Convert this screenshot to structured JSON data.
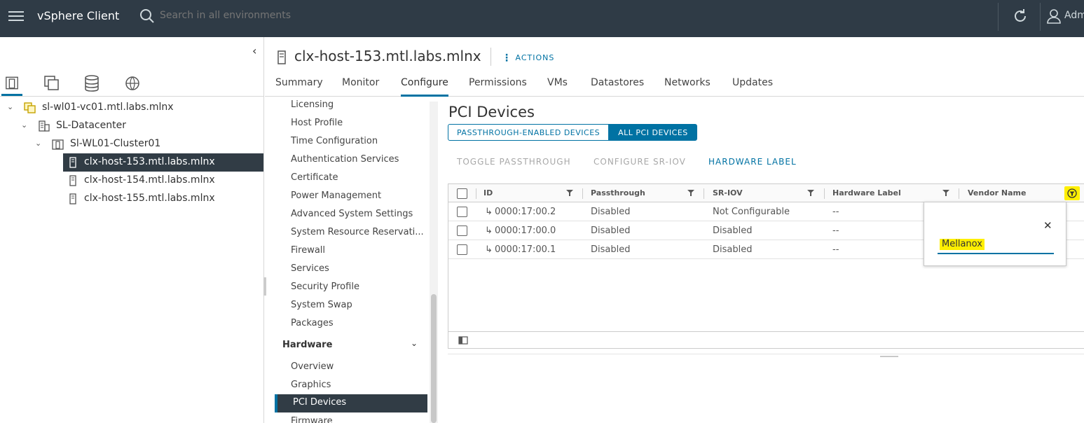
{
  "topbar": {
    "app_title": "vSphere Client",
    "search_placeholder": "Search in all environments",
    "user_label": "Adm"
  },
  "nav_tree": {
    "items": [
      {
        "label": "sl-wl01-vc01.mtl.labs.mlnx",
        "type": "vcenter",
        "expanded": true
      },
      {
        "label": "SL-Datacenter",
        "type": "datacenter",
        "expanded": true
      },
      {
        "label": "Sl-WL01-Cluster01",
        "type": "cluster",
        "expanded": true
      },
      {
        "label": "clx-host-153.mtl.labs.mlnx",
        "type": "host",
        "selected": true
      },
      {
        "label": "clx-host-154.mtl.labs.mlnx",
        "type": "host"
      },
      {
        "label": "clx-host-155.mtl.labs.mlnx",
        "type": "host"
      }
    ]
  },
  "object_header": {
    "title": "clx-host-153.mtl.labs.mlnx",
    "actions_label": "ACTIONS"
  },
  "tabs": [
    "Summary",
    "Monitor",
    "Configure",
    "Permissions",
    "VMs",
    "Datastores",
    "Networks",
    "Updates"
  ],
  "active_tab": "Configure",
  "config_menu": {
    "items": [
      "Licensing",
      "Host Profile",
      "Time Configuration",
      "Authentication Services",
      "Certificate",
      "Power Management",
      "Advanced System Settings",
      "System Resource Reservati...",
      "Firewall",
      "Services",
      "Security Profile",
      "System Swap",
      "Packages"
    ],
    "hardware_section": "Hardware",
    "hardware_items": [
      "Overview",
      "Graphics",
      "PCI Devices",
      "Firmware"
    ],
    "selected": "PCI Devices"
  },
  "pci": {
    "title": "PCI Devices",
    "view_toggle": [
      "PASSTHROUGH-ENABLED DEVICES",
      "ALL PCI DEVICES"
    ],
    "active_view": "ALL PCI DEVICES",
    "toolbar": {
      "toggle_passthrough": "TOGGLE PASSTHROUGH",
      "configure_sriov": "CONFIGURE SR-IOV",
      "hardware_label": "HARDWARE LABEL"
    },
    "columns": [
      "ID",
      "Passthrough",
      "SR-IOV",
      "Hardware Label",
      "Vendor Name"
    ],
    "rows": [
      {
        "id": "0000:17:00.2",
        "passthrough": "Disabled",
        "sriov": "Not Configurable",
        "hardware_label": "--"
      },
      {
        "id": "0000:17:00.0",
        "passthrough": "Disabled",
        "sriov": "Disabled",
        "hardware_label": "--"
      },
      {
        "id": "0000:17:00.1",
        "passthrough": "Disabled",
        "sriov": "Disabled",
        "hardware_label": "--"
      }
    ],
    "filter_popup": {
      "value": "Mellanox",
      "highlight_color": "#ffef00"
    }
  },
  "colors": {
    "topbar": "#2f3b46",
    "accent": "#0072a3",
    "selection": "#313c45"
  }
}
